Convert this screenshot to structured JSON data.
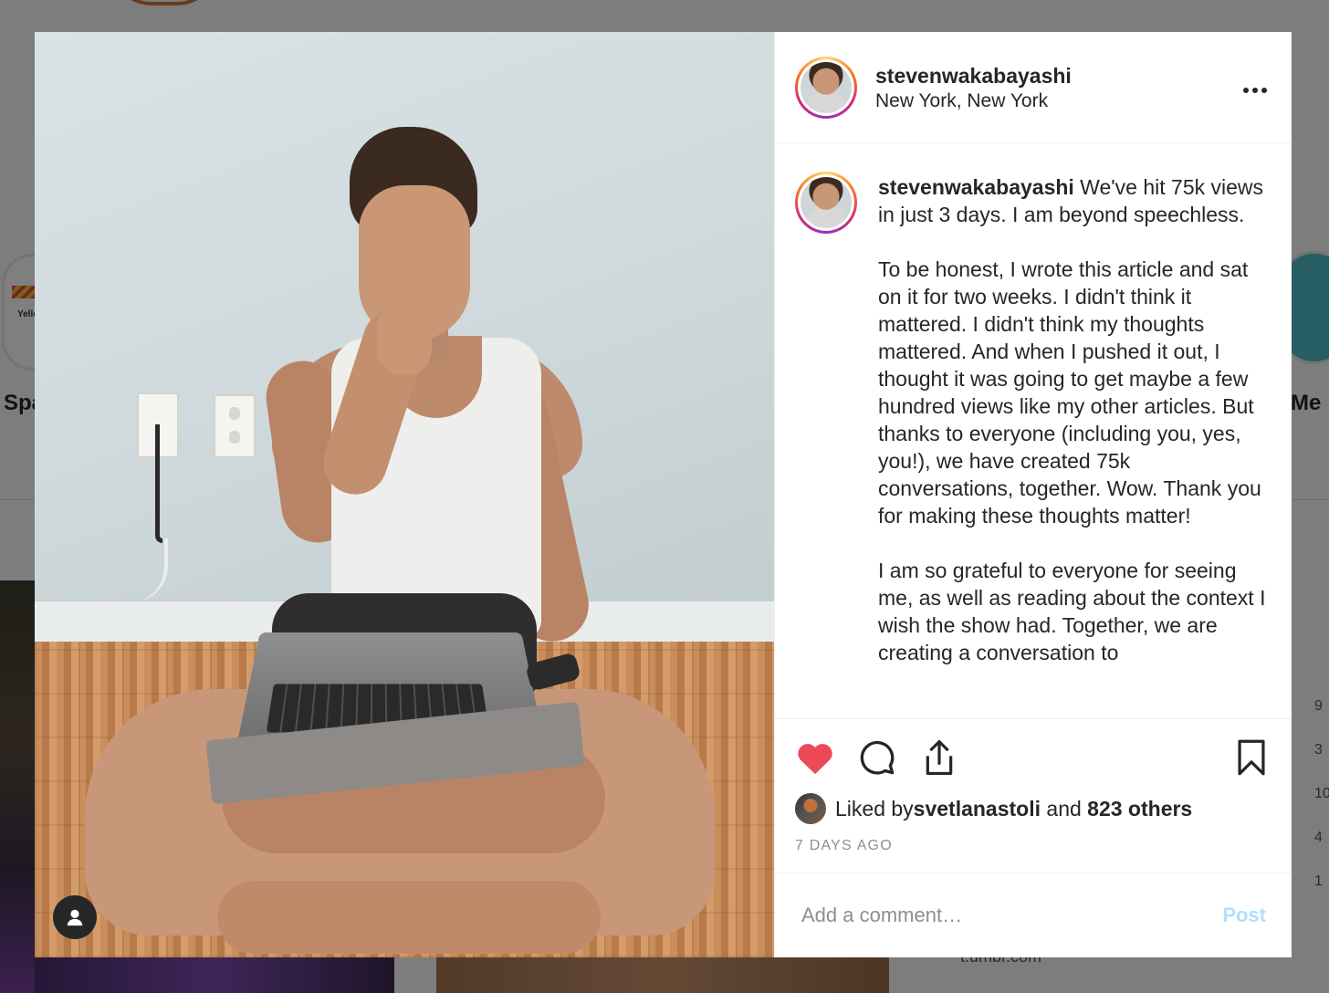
{
  "background": {
    "story_left_label": "Spa",
    "story_left_badge": "Yello",
    "story_right_label": "Me",
    "bottom_text": "t.umbr.com",
    "side_numbers": [
      "9",
      "3",
      "10",
      "4",
      "1"
    ]
  },
  "post": {
    "username": "stevenwakabayashi",
    "location": "New York, New York",
    "more_label": "•••",
    "caption": " We've hit 75k views in just 3 days. I am beyond speechless.\n\nTo be honest, I wrote this article and sat on it for two weeks. I didn't think it mattered. I didn't think my thoughts mattered. And when I pushed it out, I thought it was going to get maybe a few hundred views like my other articles. But thanks to everyone (including you, yes, you!), we have created 75k conversations, together. Wow. Thank you for making these thoughts matter!\n\nI am so grateful to everyone for seeing me, as well as reading about the context I wish the show had. Together, we are creating a conversation to",
    "liked_prefix": "Liked by ",
    "liked_user": "svetlanastoli",
    "liked_and": " and ",
    "liked_others": "823 others",
    "timestamp": "7 DAYS AGO",
    "liked": true
  },
  "comment": {
    "placeholder": "Add a comment…",
    "post_label": "Post"
  },
  "colors": {
    "heart": "#ed4956",
    "post_disabled": "#b2dffc",
    "muted": "#8e8e8e"
  },
  "icons": [
    "heart-icon",
    "comment-icon",
    "share-icon",
    "bookmark-icon",
    "user-icon",
    "more-icon"
  ]
}
